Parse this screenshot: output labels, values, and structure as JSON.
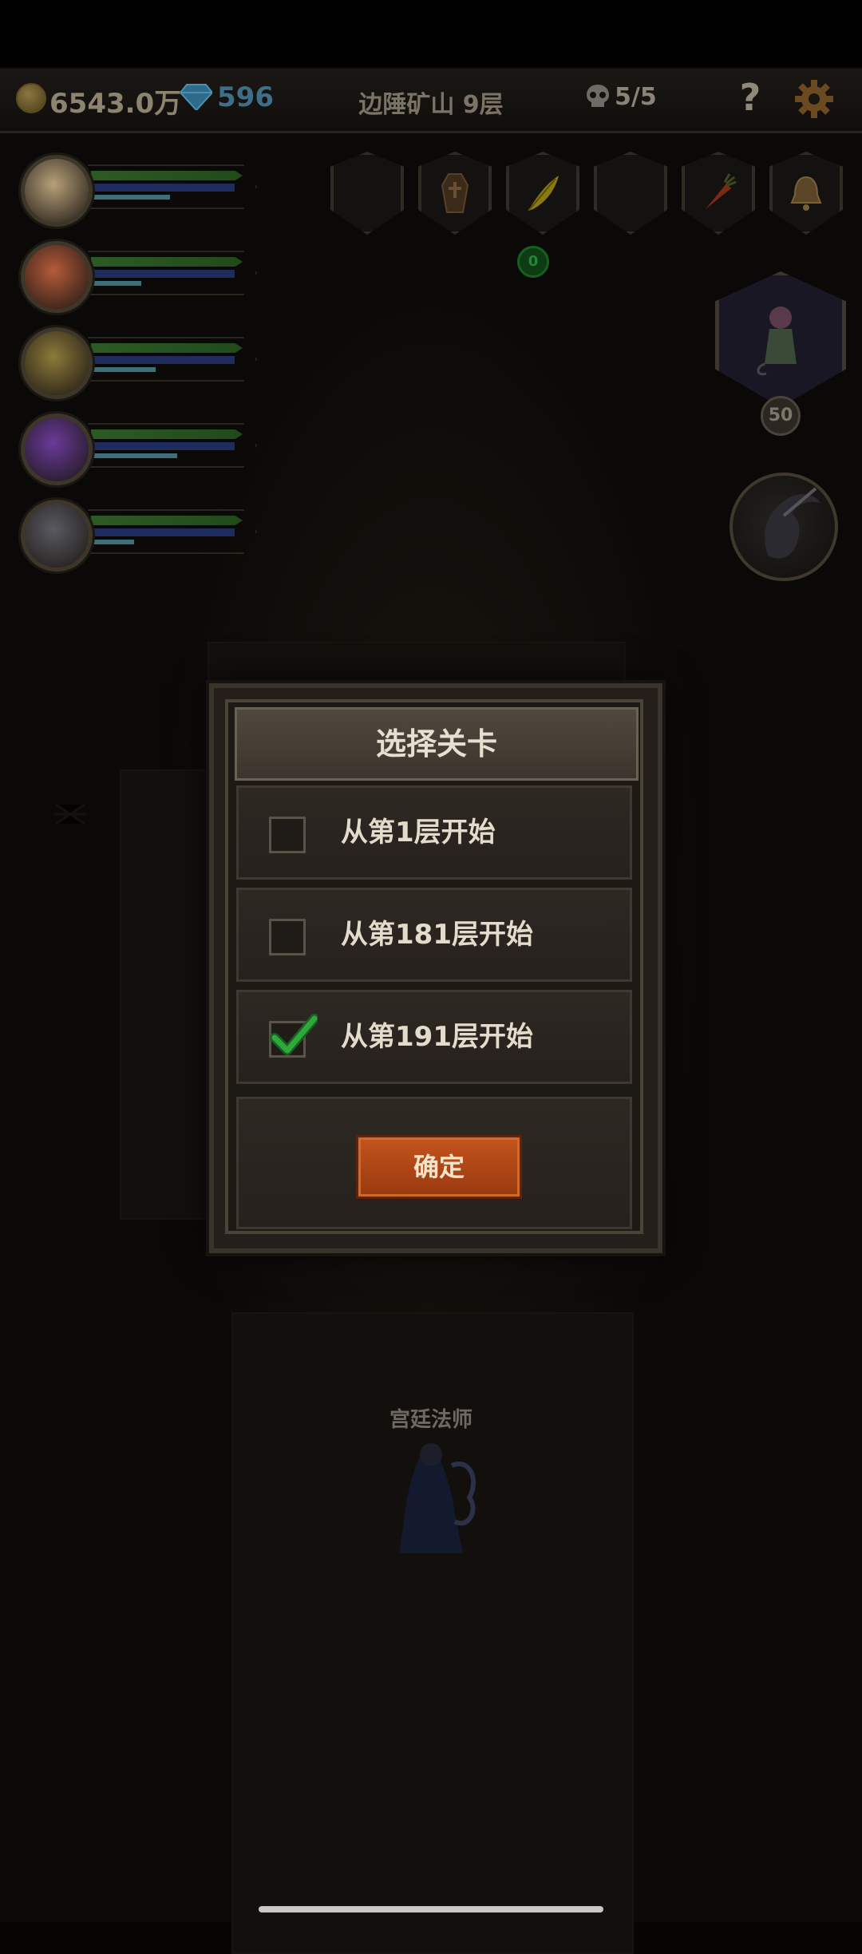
{
  "hud": {
    "gold": "6543.0万",
    "gems": "596",
    "stage": "边陲矿山 9层",
    "kills": "5/5",
    "help_label": "?",
    "icons": {
      "gold": "coin-icon",
      "gems": "diamond-icon",
      "kills": "skull-icon",
      "settings": "gear-icon"
    }
  },
  "heroes": [
    {
      "name": "hero-1",
      "hp": 1.0,
      "mp": 1.0,
      "xp": 0.55,
      "color": "#b7a07a"
    },
    {
      "name": "hero-2",
      "hp": 1.0,
      "mp": 1.0,
      "xp": 0.35,
      "color": "#b65a3a"
    },
    {
      "name": "hero-3",
      "hp": 1.0,
      "mp": 1.0,
      "xp": 0.45,
      "color": "#8d7a3a"
    },
    {
      "name": "hero-4",
      "hp": 1.0,
      "mp": 1.0,
      "xp": 0.6,
      "color": "#6a3a9a"
    },
    {
      "name": "hero-5",
      "hp": 1.0,
      "mp": 1.0,
      "xp": 0.3,
      "color": "#5a5a62"
    }
  ],
  "slots": [
    "empty",
    "coffin",
    "feather",
    "empty",
    "carrot",
    "bell"
  ],
  "slot_badge": "0",
  "pet_level": "50",
  "npc_label": "宫廷法师",
  "dialog": {
    "title": "选择关卡",
    "options": [
      {
        "label": "从第1层开始",
        "checked": false
      },
      {
        "label": "从第181层开始",
        "checked": false
      },
      {
        "label": "从第191层开始",
        "checked": true
      }
    ],
    "confirm_label": "确定"
  },
  "colors": {
    "accent": "#c2531c",
    "check": "#2fa83a"
  }
}
